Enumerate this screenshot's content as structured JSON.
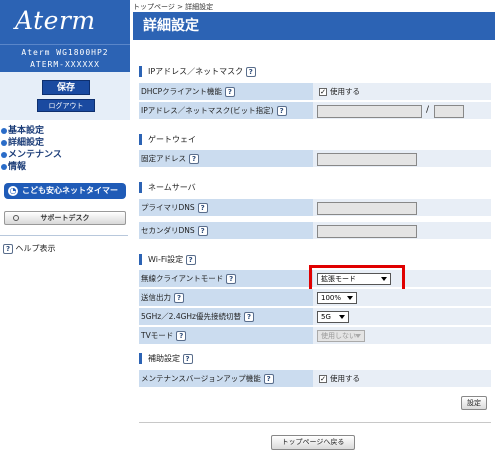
{
  "brand": {
    "logo": "Aterm",
    "model": "Aterm WG1800HP2",
    "device_name": "ATERM-XXXXXX"
  },
  "sidebar": {
    "save_label": "保存",
    "logout_label": "ログアウト",
    "nav": [
      {
        "label": "基本設定"
      },
      {
        "label": "詳細設定"
      },
      {
        "label": "メンテナンス"
      },
      {
        "label": "情報"
      }
    ],
    "kodomo_label": "こども安心ネットタイマー",
    "support_label": "サポートデスク",
    "help_label": "ヘルプ表示"
  },
  "breadcrumb": "トップページ > 詳細設定",
  "page_title": "詳細設定",
  "help_glyph": "?",
  "sections": {
    "ip": {
      "title": "IPアドレス／ネットマスク",
      "dhcp_label": "DHCPクライアント機能",
      "dhcp_check_label": "使用する",
      "ip_label": "IPアドレス／ネットマスク(ビット指定)",
      "slash": "/"
    },
    "gateway": {
      "title": "ゲートウェイ",
      "fixed_label": "固定アドレス"
    },
    "dns": {
      "title": "ネームサーバ",
      "primary_label": "プライマリDNS",
      "secondary_label": "セカンダリDNS"
    },
    "wifi": {
      "title": "Wi-Fi設定",
      "client_mode_label": "無線クライアントモード",
      "client_mode_value": "拡張モード",
      "tx_label": "送信出力",
      "tx_value": "100%",
      "band_label": "5GHz／2.4GHz優先接続切替",
      "band_value": "5G",
      "tv_label": "TVモード",
      "tv_value": "使用しない"
    },
    "aux": {
      "title": "補助設定",
      "maint_label": "メンテナンスバージョンアップ機能",
      "maint_check_label": "使用する"
    }
  },
  "set_label": "設定",
  "back_label": "トップページへ戻る",
  "colors": {
    "brand_blue": "#2c63b4",
    "label_bg": "#cbdcef",
    "highlight": "#e00000"
  }
}
